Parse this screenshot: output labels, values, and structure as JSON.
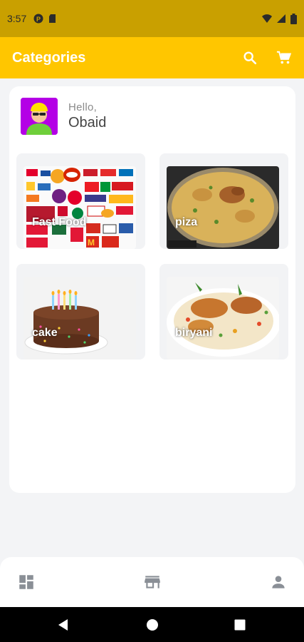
{
  "status_bar": {
    "time": "3:57"
  },
  "app_bar": {
    "title": "Categories",
    "actions": [
      "search-icon",
      "cart-icon"
    ]
  },
  "greeting": {
    "hello": "Hello,",
    "user_name": "Obaid"
  },
  "categories": [
    {
      "label": "Fast Food"
    },
    {
      "label": "piza"
    },
    {
      "label": "cake"
    },
    {
      "label": "biryani"
    }
  ],
  "bottom_nav": [
    "dashboard-icon",
    "store-icon",
    "person-icon"
  ],
  "colors": {
    "accent": "#ffc600",
    "status_bar": "#c9a000",
    "avatar_bg": "#b400e6"
  }
}
